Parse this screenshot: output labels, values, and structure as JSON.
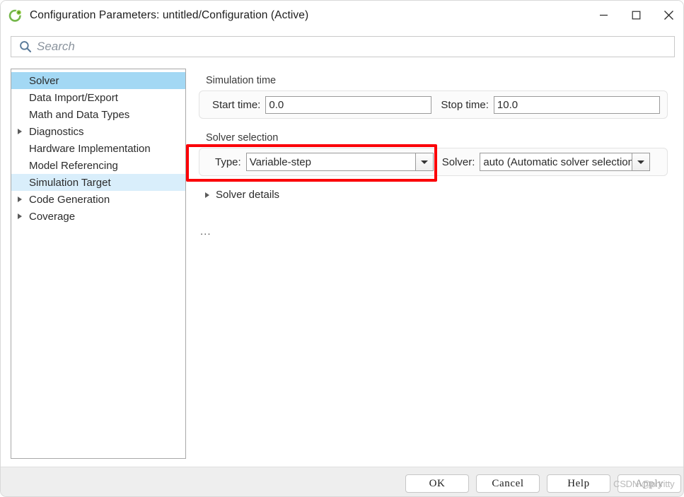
{
  "window": {
    "title": "Configuration Parameters: untitled/Configuration (Active)",
    "app_icon": "simulink-icon",
    "minimize_label": "Minimize",
    "maximize_label": "Maximize",
    "close_label": "Close"
  },
  "search": {
    "icon": "search-icon",
    "placeholder": "Search",
    "value": ""
  },
  "sidebar": {
    "items": [
      {
        "label": "Solver",
        "expandable": false,
        "state": "selected"
      },
      {
        "label": "Data Import/Export",
        "expandable": false,
        "state": "normal"
      },
      {
        "label": "Math and Data Types",
        "expandable": false,
        "state": "normal"
      },
      {
        "label": "Diagnostics",
        "expandable": true,
        "state": "normal"
      },
      {
        "label": "Hardware Implementation",
        "expandable": false,
        "state": "normal"
      },
      {
        "label": "Model Referencing",
        "expandable": false,
        "state": "normal"
      },
      {
        "label": "Simulation Target",
        "expandable": false,
        "state": "hover"
      },
      {
        "label": "Code Generation",
        "expandable": true,
        "state": "normal"
      },
      {
        "label": "Coverage",
        "expandable": true,
        "state": "normal"
      }
    ]
  },
  "main": {
    "simulation_time": {
      "group_title": "Simulation time",
      "start_time_label": "Start time:",
      "start_time_value": "0.0",
      "stop_time_label": "Stop time:",
      "stop_time_value": "10.0"
    },
    "solver_selection": {
      "group_title": "Solver selection",
      "type_label": "Type:",
      "type_value": "Variable-step",
      "solver_label": "Solver:",
      "solver_value": "auto (Automatic solver selection)"
    },
    "solver_details_label": "Solver details",
    "overflow_label": "..."
  },
  "annotation": {
    "color": "#fb0007"
  },
  "footer": {
    "ok_label": "OK",
    "cancel_label": "Cancel",
    "help_label": "Help",
    "apply_label": "Apply"
  },
  "watermark": {
    "text": "CSDN @phritty"
  }
}
